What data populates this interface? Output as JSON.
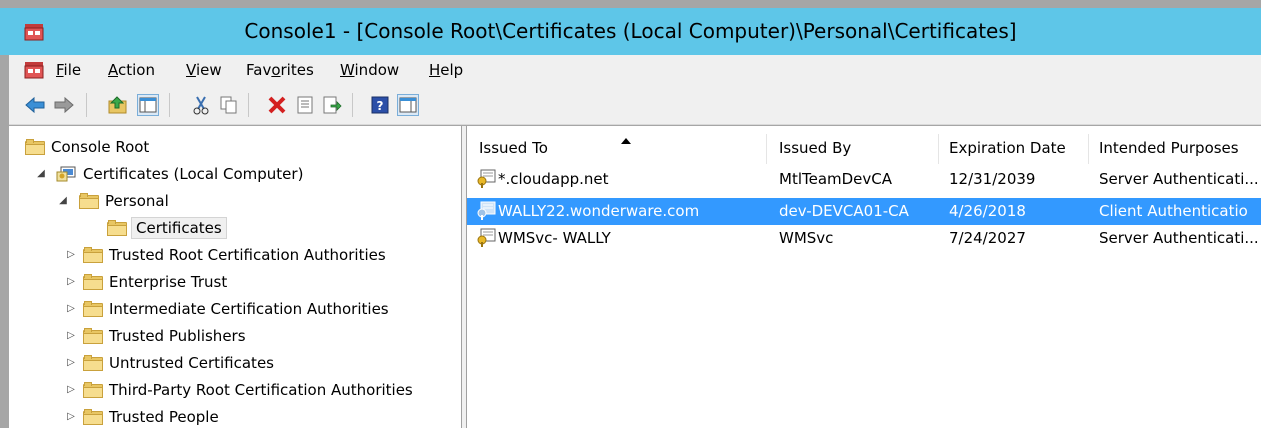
{
  "window": {
    "title": "Console1 - [Console Root\\Certificates (Local Computer)\\Personal\\Certificates]"
  },
  "menu": {
    "items": [
      {
        "label": "File",
        "accel": "F"
      },
      {
        "label": "Action",
        "accel": "A"
      },
      {
        "label": "View",
        "accel": "V"
      },
      {
        "label": "Favorites",
        "accel": "o"
      },
      {
        "label": "Window",
        "accel": "W"
      },
      {
        "label": "Help",
        "accel": "H"
      }
    ]
  },
  "toolbar": {
    "icons": [
      "back-arrow-icon",
      "forward-arrow-icon",
      "up-folder-icon",
      "show-hide-tree-icon",
      "cut-icon",
      "copy-icon",
      "delete-icon",
      "properties-icon",
      "export-list-icon",
      "help-icon",
      "show-hide-action-pane-icon"
    ]
  },
  "tree": {
    "root": "Console Root",
    "certificates_store": "Certificates (Local Computer)",
    "personal": "Personal",
    "personal_certificates": "Certificates",
    "trusted_root": "Trusted Root Certification Authorities",
    "enterprise_trust": "Enterprise Trust",
    "intermediate": "Intermediate Certification Authorities",
    "trusted_publishers": "Trusted Publishers",
    "untrusted": "Untrusted Certificates",
    "third_party_root": "Third-Party Root Certification Authorities",
    "trusted_people": "Trusted People"
  },
  "list": {
    "columns": [
      "Issued To",
      "Issued By",
      "Expiration Date",
      "Intended Purposes"
    ],
    "rows": [
      {
        "issued_to": "*.cloudapp.net",
        "issued_by": "MtlTeamDevCA",
        "expiration": "12/31/2039",
        "purposes": "Server Authenticati..."
      },
      {
        "issued_to": "WALLY22.wonderware.com",
        "issued_by": "dev-DEVCA01-CA",
        "expiration": "4/26/2018",
        "purposes": "Client Authenticatio"
      },
      {
        "issued_to": "WMSvc- WALLY",
        "issued_by": "WMSvc",
        "expiration": "7/24/2027",
        "purposes": "Server Authenticati..."
      }
    ]
  },
  "colors": {
    "titlebar": "#5ec6e8",
    "selection": "#3399ff",
    "menubar": "#f0f0f0"
  }
}
